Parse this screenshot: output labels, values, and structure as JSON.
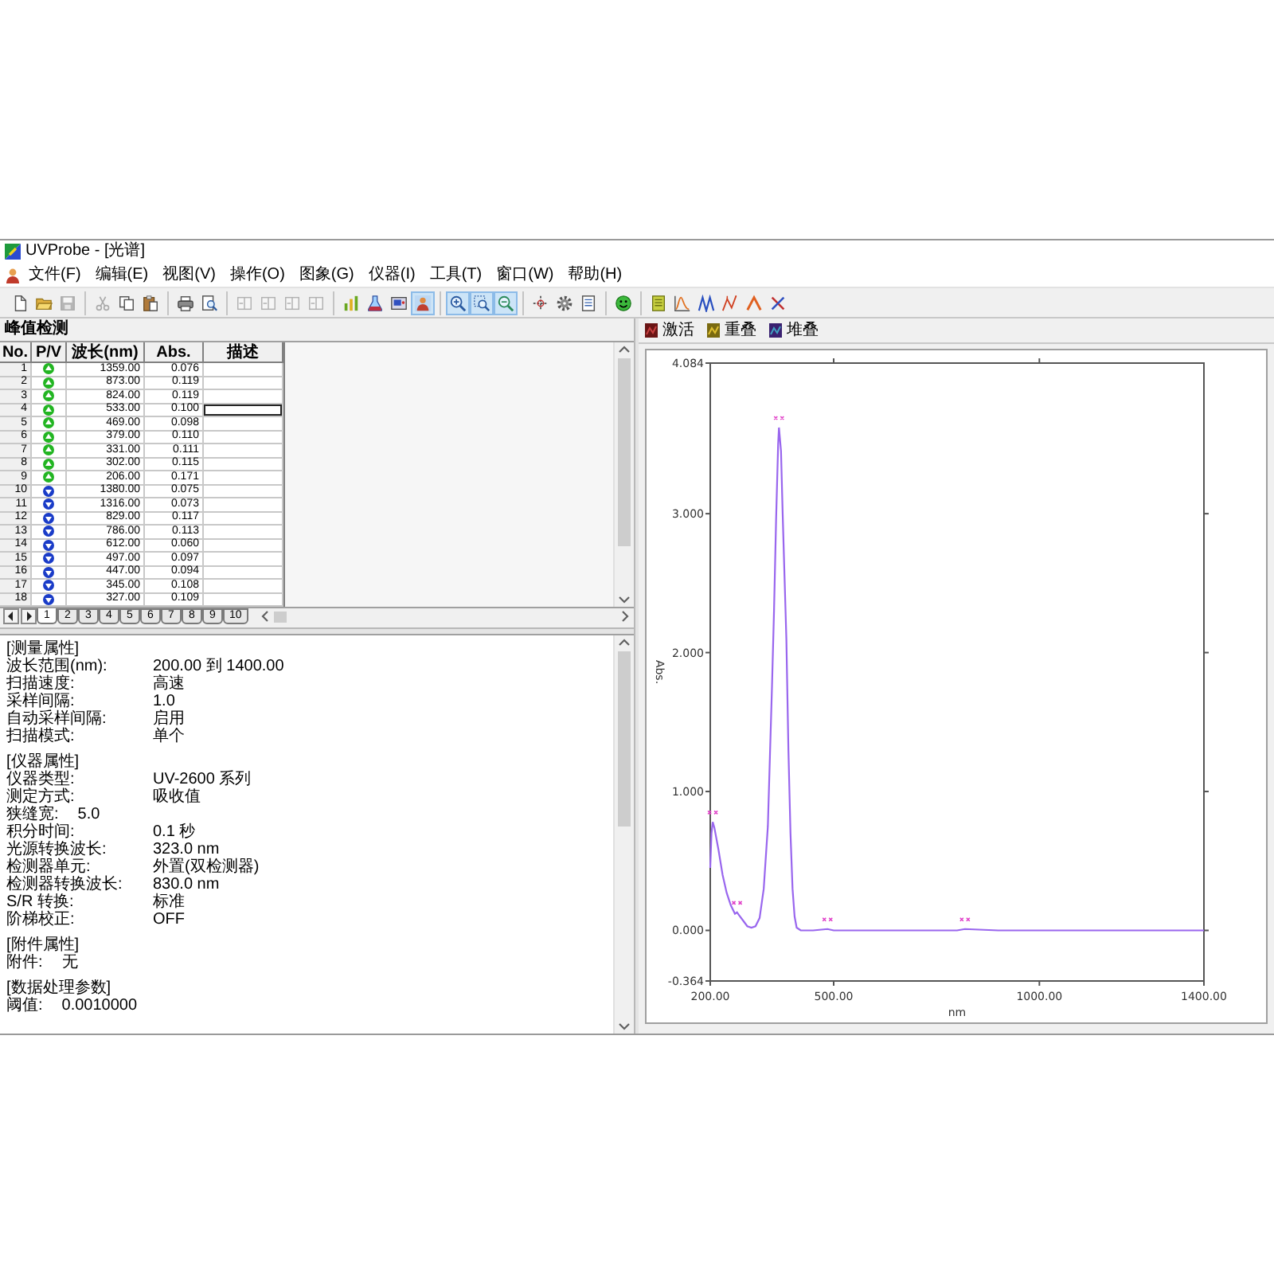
{
  "window": {
    "title": "UVProbe - [光谱]"
  },
  "menu": [
    "文件(F)",
    "编辑(E)",
    "视图(V)",
    "操作(O)",
    "图象(G)",
    "仪器(I)",
    "工具(T)",
    "窗口(W)",
    "帮助(H)"
  ],
  "toolbar": [
    [
      {
        "disabled": false,
        "pressed": false
      },
      {
        "disabled": false,
        "pressed": false
      },
      {
        "disabled": true,
        "pressed": false
      }
    ],
    [
      {
        "disabled": true,
        "pressed": false
      },
      {
        "disabled": false,
        "pressed": false
      },
      {
        "disabled": false,
        "pressed": false
      }
    ],
    [
      {
        "disabled": false,
        "pressed": false
      },
      {
        "disabled": false,
        "pressed": false
      }
    ],
    [
      {
        "disabled": true,
        "pressed": false
      },
      {
        "disabled": true,
        "pressed": false
      },
      {
        "disabled": true,
        "pressed": false
      },
      {
        "disabled": true,
        "pressed": false
      }
    ],
    [
      {
        "disabled": false,
        "pressed": false
      },
      {
        "disabled": false,
        "pressed": false
      },
      {
        "disabled": false,
        "pressed": false
      },
      {
        "disabled": false,
        "pressed": true
      }
    ],
    [
      {
        "disabled": false,
        "pressed": true
      },
      {
        "disabled": false,
        "pressed": true
      },
      {
        "disabled": false,
        "pressed": true
      }
    ],
    [
      {
        "disabled": false,
        "pressed": false
      },
      {
        "disabled": false,
        "pressed": false
      },
      {
        "disabled": false,
        "pressed": false
      }
    ],
    [
      {
        "disabled": false,
        "pressed": false
      }
    ],
    [
      {
        "disabled": false,
        "pressed": false
      },
      {
        "disabled": false,
        "pressed": false
      },
      {
        "disabled": false,
        "pressed": false
      },
      {
        "disabled": false,
        "pressed": false
      },
      {
        "disabled": false,
        "pressed": false
      },
      {
        "disabled": false,
        "pressed": false
      }
    ]
  ],
  "peak_panel": {
    "title": "峰值检测",
    "columns": [
      "No.",
      "P/V",
      "波长(nm)",
      "Abs.",
      "描述"
    ],
    "rows": [
      {
        "no": "1",
        "kind": "peak",
        "wavelength": "1359.00",
        "abs": "0.076",
        "selected": false
      },
      {
        "no": "2",
        "kind": "peak",
        "wavelength": "873.00",
        "abs": "0.119",
        "selected": false
      },
      {
        "no": "3",
        "kind": "peak",
        "wavelength": "824.00",
        "abs": "0.119",
        "selected": false
      },
      {
        "no": "4",
        "kind": "peak",
        "wavelength": "533.00",
        "abs": "0.100",
        "selected": true
      },
      {
        "no": "5",
        "kind": "peak",
        "wavelength": "469.00",
        "abs": "0.098",
        "selected": false
      },
      {
        "no": "6",
        "kind": "peak",
        "wavelength": "379.00",
        "abs": "0.110",
        "selected": false
      },
      {
        "no": "7",
        "kind": "peak",
        "wavelength": "331.00",
        "abs": "0.111",
        "selected": false
      },
      {
        "no": "8",
        "kind": "peak",
        "wavelength": "302.00",
        "abs": "0.115",
        "selected": false
      },
      {
        "no": "9",
        "kind": "peak",
        "wavelength": "206.00",
        "abs": "0.171",
        "selected": false
      },
      {
        "no": "10",
        "kind": "valley",
        "wavelength": "1380.00",
        "abs": "0.075",
        "selected": false
      },
      {
        "no": "11",
        "kind": "valley",
        "wavelength": "1316.00",
        "abs": "0.073",
        "selected": false
      },
      {
        "no": "12",
        "kind": "valley",
        "wavelength": "829.00",
        "abs": "0.117",
        "selected": false
      },
      {
        "no": "13",
        "kind": "valley",
        "wavelength": "786.00",
        "abs": "0.113",
        "selected": false
      },
      {
        "no": "14",
        "kind": "valley",
        "wavelength": "612.00",
        "abs": "0.060",
        "selected": false
      },
      {
        "no": "15",
        "kind": "valley",
        "wavelength": "497.00",
        "abs": "0.097",
        "selected": false
      },
      {
        "no": "16",
        "kind": "valley",
        "wavelength": "447.00",
        "abs": "0.094",
        "selected": false
      },
      {
        "no": "17",
        "kind": "valley",
        "wavelength": "345.00",
        "abs": "0.108",
        "selected": false
      },
      {
        "no": "18",
        "kind": "valley",
        "wavelength": "327.00",
        "abs": "0.109",
        "selected": false
      }
    ],
    "sheet_tabs": [
      {
        "label": "1",
        "selected": true
      },
      {
        "label": "2",
        "selected": false
      },
      {
        "label": "3",
        "selected": false
      },
      {
        "label": "4",
        "selected": false
      },
      {
        "label": "5",
        "selected": false
      },
      {
        "label": "6",
        "selected": false
      },
      {
        "label": "7",
        "selected": false
      },
      {
        "label": "8",
        "selected": false
      },
      {
        "label": "9",
        "selected": false
      },
      {
        "label": "10",
        "selected": false
      }
    ]
  },
  "properties": [
    {
      "heading": "[测量属性]",
      "lines": [
        {
          "kind": "field",
          "label": "波长范围(nm):",
          "value": "200.00 到 1400.00"
        },
        {
          "kind": "field",
          "label": "扫描速度:",
          "value": "高速"
        },
        {
          "kind": "field",
          "label": "采样间隔:",
          "value": "1.0"
        },
        {
          "kind": "field",
          "label": "自动采样间隔:",
          "value": "启用"
        },
        {
          "kind": "field",
          "label": "扫描模式:",
          "value": "单个"
        }
      ]
    },
    {
      "heading": "[仪器属性]",
      "lines": [
        {
          "kind": "field",
          "label": "仪器类型:",
          "value": "UV-2600 系列"
        },
        {
          "kind": "field",
          "label": "测定方式:",
          "value": "吸收值"
        },
        {
          "kind": "inline",
          "label": "狭缝宽:",
          "value": "5.0"
        },
        {
          "kind": "field",
          "label": "积分时间:",
          "value": "0.1 秒"
        },
        {
          "kind": "field",
          "label": "光源转换波长:",
          "value": "323.0 nm"
        },
        {
          "kind": "field",
          "label": "检测器单元:",
          "value": "外置(双检测器)"
        },
        {
          "kind": "field",
          "label": "检测器转换波长:",
          "value": "830.0 nm"
        },
        {
          "kind": "field",
          "label": "S/R 转换:",
          "value": "标准"
        },
        {
          "kind": "field",
          "label": "阶梯校正:",
          "value": "OFF"
        }
      ]
    },
    {
      "heading": "[附件属性]",
      "lines": [
        {
          "kind": "inline",
          "label": "附件:",
          "value": "无"
        }
      ]
    },
    {
      "heading": "[数据处理参数]",
      "lines": [
        {
          "kind": "inline",
          "label": "阈值:",
          "value": "0.0010000"
        }
      ]
    }
  ],
  "chart_panel": {
    "modes": [
      "激活",
      "重叠",
      "堆叠"
    ],
    "chart_data": {
      "type": "line",
      "xlabel": "nm",
      "ylabel": "Abs.",
      "x": [
        200,
        203,
        206,
        210,
        220,
        230,
        240,
        250,
        260,
        265,
        270,
        280,
        290,
        300,
        310,
        320,
        330,
        340,
        345,
        350,
        355,
        360,
        365,
        367,
        372,
        376,
        380,
        385,
        390,
        395,
        400,
        405,
        410,
        420,
        450,
        485,
        500,
        600,
        700,
        800,
        819,
        900,
        1000,
        1100,
        1200,
        1300,
        1400
      ],
      "series": [
        {
          "color": "#9966ee",
          "values": [
            0.45,
            0.7,
            0.78,
            0.74,
            0.58,
            0.4,
            0.27,
            0.18,
            0.12,
            0.13,
            0.11,
            0.07,
            0.03,
            0.02,
            0.03,
            0.09,
            0.3,
            0.75,
            1.25,
            1.75,
            2.3,
            2.95,
            3.5,
            3.62,
            3.45,
            3.0,
            2.6,
            2.1,
            1.3,
            0.7,
            0.3,
            0.1,
            0.02,
            0.0,
            0.0,
            0.01,
            0.0,
            0.0,
            0.0,
            0.0,
            0.01,
            0.0,
            0.0,
            0.0,
            0.0,
            0.0,
            0.0
          ]
        }
      ],
      "xlim": [
        200,
        1400
      ],
      "ylim": [
        -0.364,
        4.084
      ],
      "xticks": [
        {
          "value": 200,
          "label": "200.00"
        },
        {
          "value": 500,
          "label": "500.00"
        },
        {
          "value": 1000,
          "label": "1000.00"
        },
        {
          "value": 1400,
          "label": "1400.00"
        }
      ],
      "yticks": [
        {
          "value": 4.084,
          "label": "4.084"
        },
        {
          "value": 3,
          "label": "3.000"
        },
        {
          "value": 2,
          "label": "2.000"
        },
        {
          "value": 1,
          "label": "1.000"
        },
        {
          "value": 0,
          "label": "0.000"
        },
        {
          "value": -0.364,
          "label": "-0.364"
        }
      ]
    }
  }
}
